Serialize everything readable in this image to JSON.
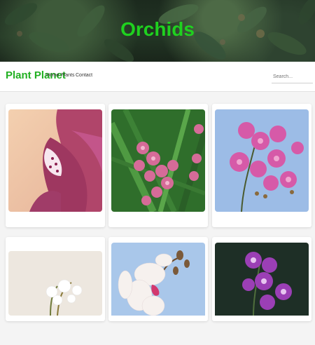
{
  "hero": {
    "title": "Orchids"
  },
  "navbar": {
    "brand": "Plant Planet",
    "links": [
      "Home",
      "Plants",
      "Contact"
    ],
    "search_placeholder": "Search..."
  },
  "gallery": {
    "next_label": "›",
    "cards": [
      {
        "name": "orchid-card-1",
        "subject": "pink orchid close-up"
      },
      {
        "name": "orchid-card-2",
        "subject": "pink orchid spray"
      },
      {
        "name": "orchid-card-3",
        "subject": "magenta orchids against sky"
      },
      {
        "name": "orchid-card-4",
        "subject": "white orchid"
      },
      {
        "name": "orchid-card-5",
        "subject": "white and pink orchid"
      },
      {
        "name": "orchid-card-6",
        "subject": "purple orchids"
      }
    ]
  },
  "colors": {
    "brand": "#22b022",
    "hero_title": "#1fd11f"
  }
}
